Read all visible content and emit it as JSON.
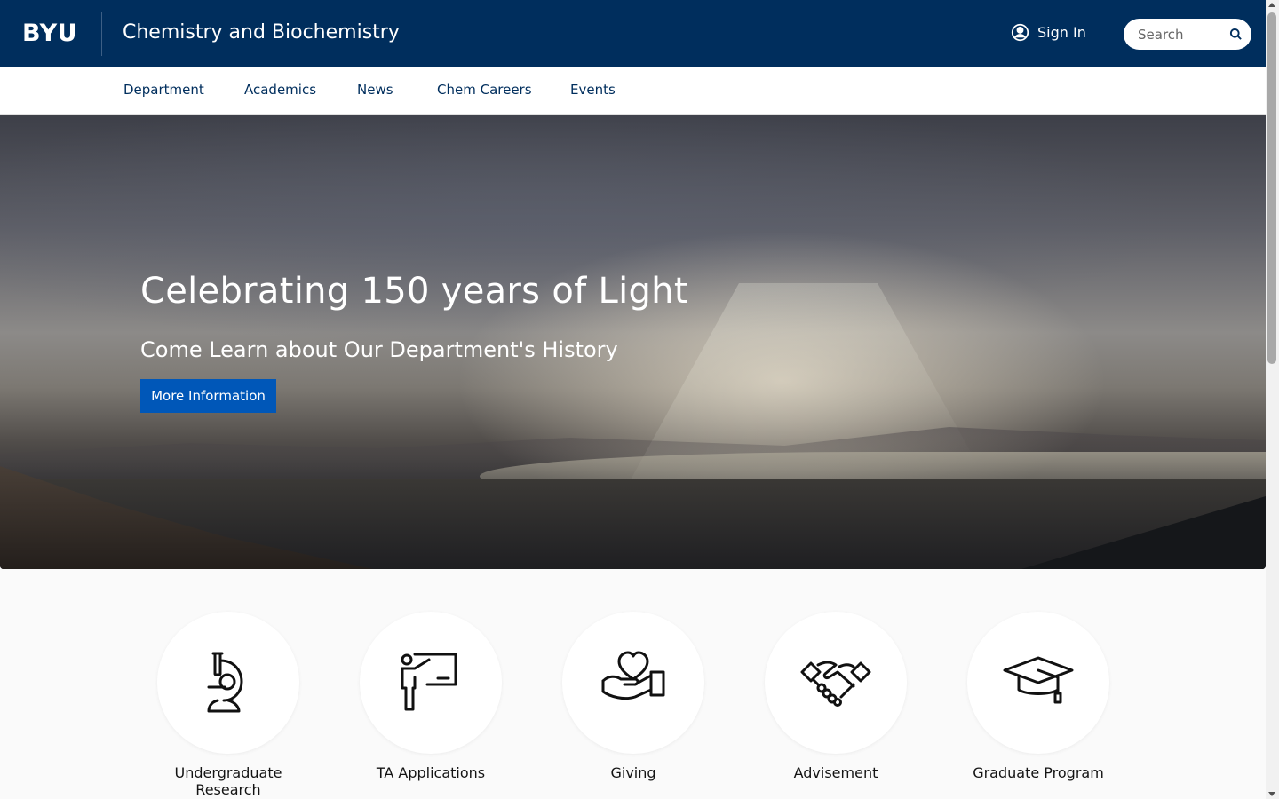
{
  "header": {
    "logo": "BYU",
    "site_title": "Chemistry and Biochemistry",
    "signin_label": "Sign In",
    "search_placeholder": "Search"
  },
  "nav": {
    "items": [
      "Department",
      "Academics",
      "News",
      "Chem Careers",
      "Events"
    ]
  },
  "hero": {
    "title": "Celebrating 150 years of Light",
    "subtitle": "Come Learn about Our Department's History",
    "button_label": "More Information"
  },
  "quick_links": [
    {
      "label": "Undergraduate Research",
      "icon": "microscope-icon"
    },
    {
      "label": "TA Applications",
      "icon": "teacher-whiteboard-icon"
    },
    {
      "label": "Giving",
      "icon": "heart-in-hand-icon"
    },
    {
      "label": "Advisement",
      "icon": "handshake-icon"
    },
    {
      "label": "Graduate Program",
      "icon": "graduation-cap-icon"
    }
  ],
  "colors": {
    "header_bg": "#002e5d",
    "nav_text": "#002e5d",
    "button_bg": "#0057b8",
    "page_bg": "#fafafa"
  }
}
